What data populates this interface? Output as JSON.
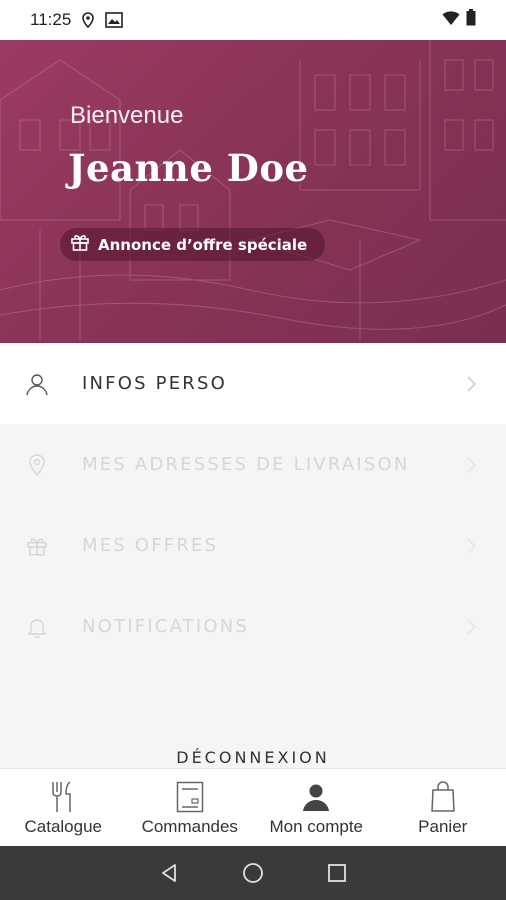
{
  "status_bar": {
    "time": "11:25",
    "icons": [
      "location-icon",
      "image-notification-icon",
      "wifi-icon",
      "battery-icon"
    ]
  },
  "hero": {
    "greeting": "Bienvenue",
    "name": "Jeanne Doe",
    "offer_label": "Annonce d’offre spéciale",
    "offer_icon": "gift-icon",
    "colors": {
      "bg": "#8a3457",
      "pill": "#5a1a36"
    }
  },
  "menu": {
    "items": [
      {
        "label": "INFOS PERSO",
        "icon": "user-icon",
        "enabled": true
      },
      {
        "label": "MES ADRESSES DE LIVRAISON",
        "icon": "location-pin-icon",
        "enabled": false
      },
      {
        "label": "MES OFFRES",
        "icon": "gift-icon",
        "enabled": false
      },
      {
        "label": "NOTIFICATIONS",
        "icon": "bell-icon",
        "enabled": false
      }
    ],
    "logout_label": "DÉCONNEXION"
  },
  "bottom_nav": {
    "items": [
      {
        "label": "Catalogue",
        "icon": "fork-knife-icon"
      },
      {
        "label": "Commandes",
        "icon": "orders-icon"
      },
      {
        "label": "Mon compte",
        "icon": "user-filled-icon",
        "active": true
      },
      {
        "label": "Panier",
        "icon": "shopping-bag-icon"
      }
    ]
  },
  "system_nav": {
    "icons": [
      "back-icon",
      "home-icon",
      "recents-icon"
    ]
  }
}
